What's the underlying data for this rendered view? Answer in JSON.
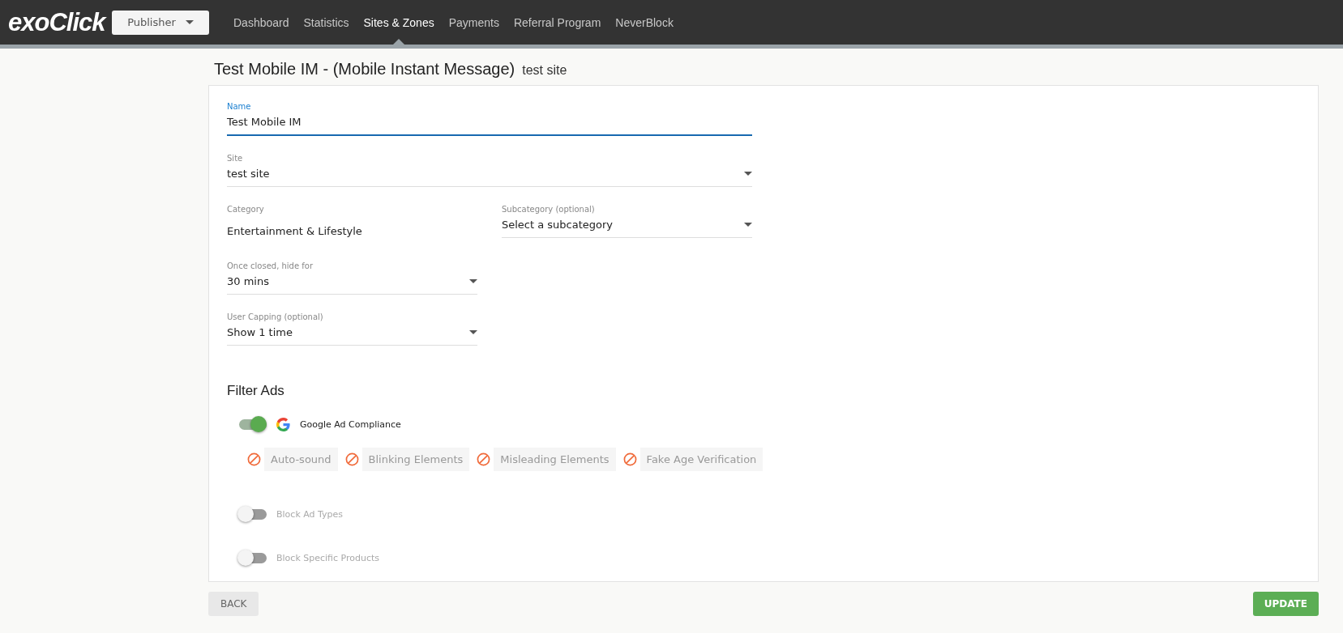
{
  "topbar": {
    "logo": "exoClick",
    "role_dropdown": "Publisher",
    "nav": [
      {
        "label": "Dashboard",
        "selected": false
      },
      {
        "label": "Statistics",
        "selected": false
      },
      {
        "label": "Sites & Zones",
        "selected": true
      },
      {
        "label": "Payments",
        "selected": false
      },
      {
        "label": "Referral Program",
        "selected": false
      },
      {
        "label": "NeverBlock",
        "selected": false
      }
    ]
  },
  "page_title": {
    "title": "Test Mobile IM - (Mobile Instant Message)",
    "subtitle": "test site"
  },
  "form": {
    "name_field": {
      "label": "Name",
      "value": "Test Mobile IM",
      "focused": true
    },
    "site_field": {
      "label": "Site",
      "value": "test site",
      "kind": "select"
    },
    "left_column": [
      {
        "label": "Category",
        "value": "Entertainment & Lifestyle",
        "kind": "static"
      },
      {
        "label": "Once closed, hide for",
        "value": "30 mins",
        "kind": "select"
      },
      {
        "label": "User Capping (optional)",
        "value": "Show 1 time",
        "kind": "select"
      }
    ],
    "right_column": [
      {
        "label": "Subcategory (optional)",
        "value": "Select a subcategory",
        "kind": "select"
      }
    ],
    "filter_title": "Filter Ads",
    "toggles": [
      {
        "label": "Google Ad Compliance",
        "on": true,
        "chips": [
          "Auto-sound",
          "Blinking Elements",
          "Misleading Elements",
          "Fake Age Verification"
        ]
      },
      {
        "label": "Block Ad Types",
        "on": false
      },
      {
        "label": "Block Specific Products",
        "on": false
      }
    ]
  },
  "footer": {
    "back": "BACK",
    "update": "UPDATE"
  }
}
